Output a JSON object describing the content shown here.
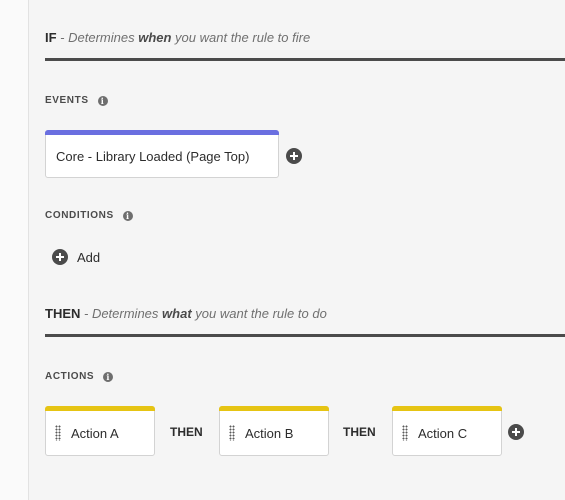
{
  "if_section": {
    "keyword": "IF",
    "desc_prefix": " - Determines ",
    "desc_bold": "when",
    "desc_suffix": " you want the rule to fire"
  },
  "events": {
    "label": "EVENTS",
    "info_glyph": "i",
    "items": [
      {
        "label": "Core - Library Loaded (Page Top)",
        "accent_color": "#6a6fe0"
      }
    ]
  },
  "conditions": {
    "label": "CONDITIONS",
    "info_glyph": "i",
    "add_label": "Add"
  },
  "then_section": {
    "keyword": "THEN",
    "desc_prefix": " - Determines ",
    "desc_bold": "what",
    "desc_suffix": " you want the rule to do"
  },
  "actions": {
    "label": "ACTIONS",
    "info_glyph": "i",
    "accent_color": "#e6c413",
    "connector": "THEN",
    "items": [
      {
        "label": "Action A"
      },
      {
        "label": "Action B"
      },
      {
        "label": "Action C"
      }
    ]
  }
}
